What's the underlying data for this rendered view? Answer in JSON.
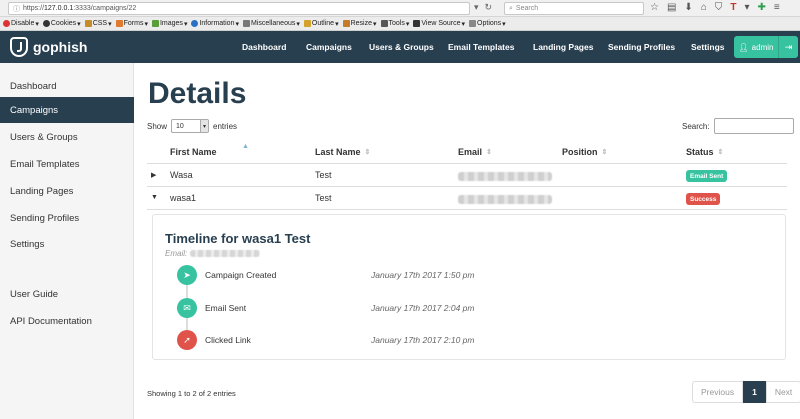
{
  "browser": {
    "url_prefix": "https://",
    "url_host": "127.0.0.1",
    "url_path": ":3333/campaigns/22",
    "search_placeholder": "Search",
    "dev_toolbar": [
      "Disable",
      "Cookies",
      "CSS",
      "Forms",
      "Images",
      "Information",
      "Miscellaneous",
      "Outline",
      "Resize",
      "Tools",
      "View Source",
      "Options"
    ]
  },
  "app": {
    "brand": "gophish",
    "nav": [
      "Dashboard",
      "Campaigns",
      "Users & Groups",
      "Email Templates",
      "Landing Pages",
      "Sending Profiles",
      "Settings"
    ],
    "user": "admin"
  },
  "sidebar": {
    "items": [
      "Dashboard",
      "Campaigns",
      "Users & Groups",
      "Email Templates",
      "Landing Pages",
      "Sending Profiles",
      "Settings"
    ],
    "bottom_items": [
      "User Guide",
      "API Documentation"
    ],
    "active": "Campaigns"
  },
  "page": {
    "title": "Details",
    "show_label": "Show",
    "show_value": "10",
    "entries_label": "entries",
    "search_label": "Search:"
  },
  "table": {
    "headers": [
      "First Name",
      "Last Name",
      "Email",
      "Position",
      "Status"
    ],
    "rows": [
      {
        "first": "Wasa",
        "last": "Test",
        "status": "Email Sent",
        "status_color": "#37c2a0"
      },
      {
        "first": "wasa1",
        "last": "Test",
        "status": "Success",
        "status_color": "#e0534a"
      }
    ]
  },
  "timeline": {
    "title": "Timeline for wasa1 Test",
    "email_label": "Email:",
    "events": [
      {
        "name": "Campaign Created",
        "time": "January 17th 2017 1:50 pm",
        "color": "#37c2a0",
        "icon": "rocket-icon",
        "glyph": "➤"
      },
      {
        "name": "Email Sent",
        "time": "January 17th 2017 2:04 pm",
        "color": "#37c2a0",
        "icon": "envelope-icon",
        "glyph": "✉"
      },
      {
        "name": "Clicked Link",
        "time": "January 17th 2017 2:10 pm",
        "color": "#e0534a",
        "icon": "pointer-icon",
        "glyph": "➚"
      }
    ]
  },
  "footer": {
    "info": "Showing 1 to 2 of 2 entries",
    "prev": "Previous",
    "page": "1",
    "next": "Next"
  }
}
